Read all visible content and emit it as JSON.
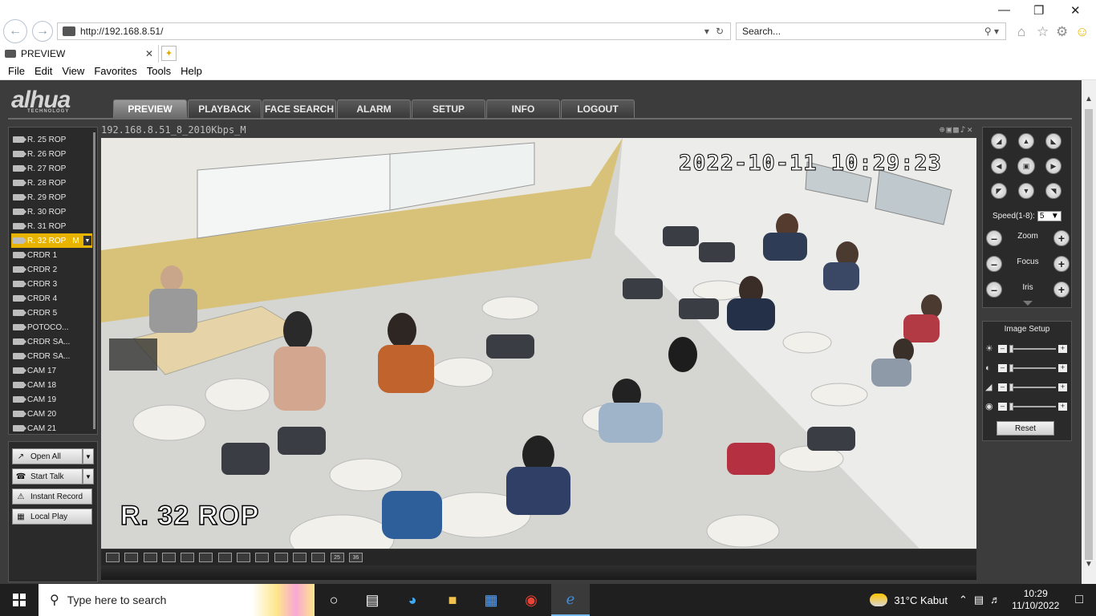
{
  "browser": {
    "url": "http://192.168.8.51/",
    "search_placeholder": "Search...",
    "tab_title": "PREVIEW",
    "menu": [
      "File",
      "Edit",
      "View",
      "Favorites",
      "Tools",
      "Help"
    ]
  },
  "app": {
    "brand": "alhua",
    "brand_sub": "TECHNOLOGY",
    "tabs": [
      "PREVIEW",
      "PLAYBACK",
      "FACE SEARCH",
      "ALARM",
      "SETUP",
      "INFO",
      "LOGOUT"
    ],
    "active_tab": "PREVIEW"
  },
  "channels": [
    {
      "label": "R. 25 ROP",
      "active": false
    },
    {
      "label": "R. 26 ROP",
      "active": false
    },
    {
      "label": "R. 27 ROP",
      "active": false
    },
    {
      "label": "R. 28 ROP",
      "active": false
    },
    {
      "label": "R. 29 ROP",
      "active": false
    },
    {
      "label": "R. 30 ROP",
      "active": false
    },
    {
      "label": "R. 31 ROP",
      "active": false
    },
    {
      "label": "R. 32 ROP",
      "active": true,
      "suffix": "M"
    },
    {
      "label": "CRDR 1",
      "active": false
    },
    {
      "label": "CRDR 2",
      "active": false
    },
    {
      "label": "CRDR 3",
      "active": false
    },
    {
      "label": "CRDR 4",
      "active": false
    },
    {
      "label": "CRDR 5",
      "active": false
    },
    {
      "label": "POTOCO...",
      "active": false
    },
    {
      "label": "CRDR SA...",
      "active": false
    },
    {
      "label": "CRDR SA...",
      "active": false
    },
    {
      "label": "CAM 17",
      "active": false
    },
    {
      "label": "CAM 18",
      "active": false
    },
    {
      "label": "CAM 19",
      "active": false
    },
    {
      "label": "CAM 20",
      "active": false
    },
    {
      "label": "CAM 21",
      "active": false
    }
  ],
  "controls": {
    "open_all": "Open All",
    "start_talk": "Start Talk",
    "instant_record": "Instant Record",
    "local_play": "Local Play"
  },
  "video": {
    "stream_info": "192.168.8.51_8_2010Kbps_M",
    "timestamp": "2022-10-11  10:29:23",
    "overlay_label": "R. 32 ROP"
  },
  "layouts": [
    "1",
    "1",
    "1",
    "1",
    "1",
    "4",
    "6",
    "8",
    "9",
    "13",
    "16",
    "20",
    "25",
    "36"
  ],
  "ptz": {
    "speed_label": "Speed(1-8):",
    "speed_value": "5",
    "zoom_label": "Zoom",
    "focus_label": "Focus",
    "iris_label": "Iris"
  },
  "image_setup": {
    "title": "Image Setup",
    "reset_label": "Reset"
  },
  "taskbar": {
    "search_placeholder": "Type here to search",
    "weather": "31°C  Kabut",
    "time": "10:29",
    "date": "11/10/2022"
  }
}
